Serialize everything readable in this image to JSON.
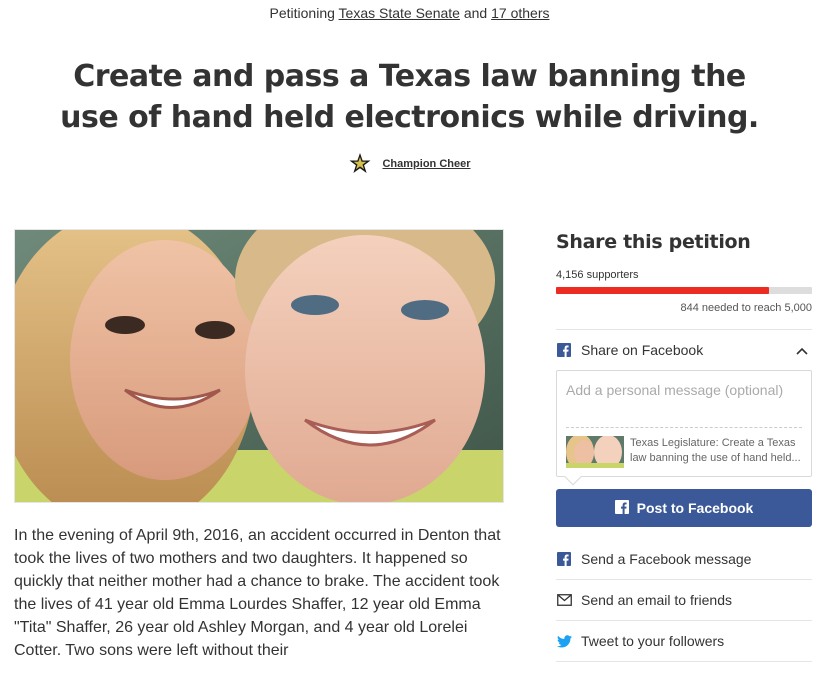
{
  "header": {
    "petitioning_prefix": "Petitioning",
    "target": "Texas State Senate",
    "and_text": "and",
    "others": "17 others"
  },
  "petition": {
    "title": "Create and pass a Texas law banning the use of hand held electronics while driving.",
    "starter_name": "Champion Cheer"
  },
  "story": {
    "text": "In the evening of April 9th, 2016, an accident occurred in Denton that took the lives of two mothers and two daughters. It happened so quickly that neither mother had a chance to brake. The accident took the lives of 41 year old Emma Lourdes Shaffer, 12 year old Emma \"Tita\" Shaffer, 26 year old Ashley Morgan, and 4 year old Lorelei Cotter. Two sons were left without their"
  },
  "share": {
    "title": "Share this petition",
    "supporters": "4,156 supporters",
    "needed": "844 needed to reach 5,000",
    "progress_fraction": 0.8312,
    "facebook_label": "Share on Facebook",
    "message_placeholder": "Add a personal message (optional)",
    "preview_text": "Texas Legislature: Create a Texas law banning the use of hand held...",
    "post_button": "Post to Facebook",
    "fb_message": "Send a Facebook message",
    "email": "Send an email to friends",
    "tweet": "Tweet to your followers"
  },
  "colors": {
    "progress": "#ec2c22",
    "facebook": "#3b5998",
    "twitter": "#1da1f2"
  }
}
